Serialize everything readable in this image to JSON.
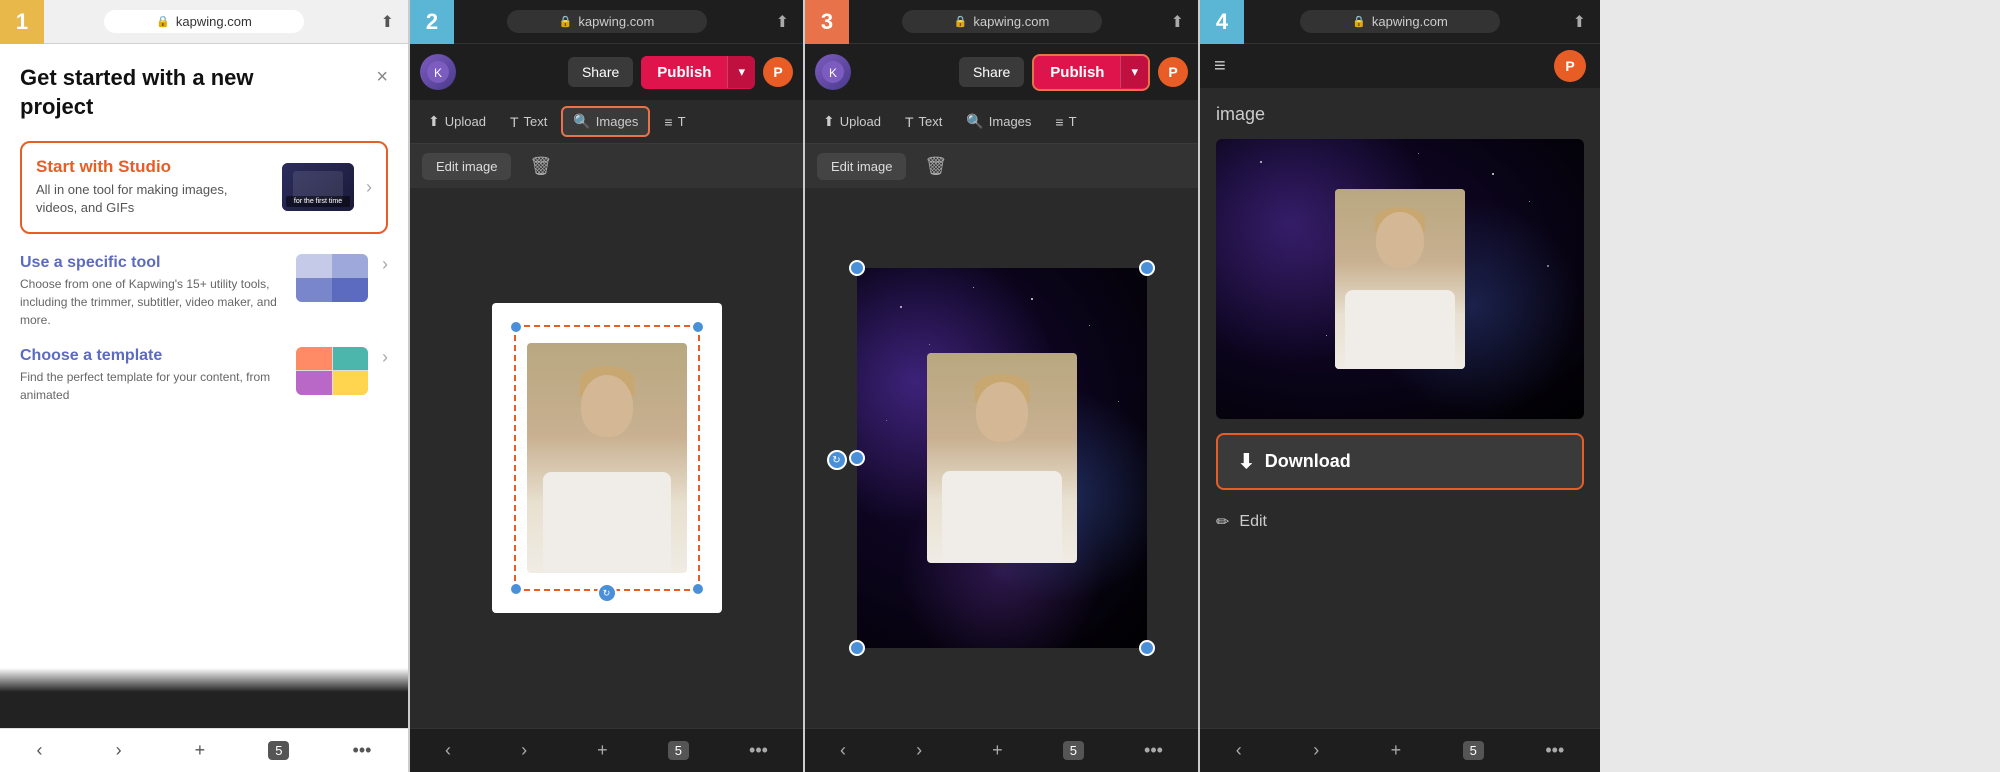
{
  "panels": [
    {
      "id": "panel-1",
      "step": "1",
      "step_color": "#e8b84b",
      "browser": {
        "url": "kapwing.com",
        "lock": "🔒"
      },
      "title": "Get started with a new project",
      "close_label": "×",
      "cards": [
        {
          "title": "Start with Studio",
          "description": "All in one tool for making images, videos, and GIFs",
          "highlighted": true
        },
        {
          "title": "Use a specific tool",
          "description": "Choose from one of Kapwing's 15+ utility tools, including the trimmer, subtitler, video maker, and more.",
          "highlighted": false
        },
        {
          "title": "Choose a template",
          "description": "Find the perfect template for your content, from animated",
          "highlighted": false
        }
      ],
      "nav": {
        "back": "‹",
        "forward": "›",
        "add": "+",
        "tabs": "5",
        "more": "•••"
      }
    },
    {
      "id": "panel-2",
      "step": "2",
      "step_color": "#5bb5d5",
      "browser": {
        "url": "kapwing.com"
      },
      "topbar": {
        "share_label": "Share",
        "publish_label": "Publish",
        "dropdown_arrow": "▾",
        "avatar_label": "P"
      },
      "toolbar": {
        "upload_label": "Upload",
        "text_label": "Text",
        "images_label": "Images",
        "more_label": "T"
      },
      "subtoolbar": {
        "edit_image_label": "Edit image",
        "delete_label": "🗑"
      },
      "active_tool": "Images",
      "nav": {
        "back": "‹",
        "forward": "›",
        "add": "+",
        "tabs": "5",
        "more": "•••"
      }
    },
    {
      "id": "panel-3",
      "step": "3",
      "step_color": "#e8734a",
      "browser": {
        "url": "kapwing.com"
      },
      "topbar": {
        "share_label": "Share",
        "publish_label": "Publish",
        "dropdown_arrow": "▾",
        "avatar_label": "P"
      },
      "toolbar": {
        "upload_label": "Upload",
        "text_label": "Text",
        "images_label": "Images",
        "more_label": "T"
      },
      "subtoolbar": {
        "edit_image_label": "Edit image",
        "delete_label": "🗑"
      },
      "active_tool": "Publish",
      "nav": {
        "back": "‹",
        "forward": "›",
        "add": "+",
        "tabs": "5",
        "more": "•••"
      }
    },
    {
      "id": "panel-4",
      "step": "4",
      "step_color": "#5bb5d5",
      "browser": {
        "url": "kapwing.com"
      },
      "topbar": {
        "hamburger": "≡",
        "avatar_label": "P"
      },
      "image_label": "image",
      "download_label": "Download",
      "edit_label": "Edit",
      "nav": {
        "back": "‹",
        "forward": "›",
        "add": "+",
        "tabs": "5",
        "more": "•••"
      }
    }
  ]
}
